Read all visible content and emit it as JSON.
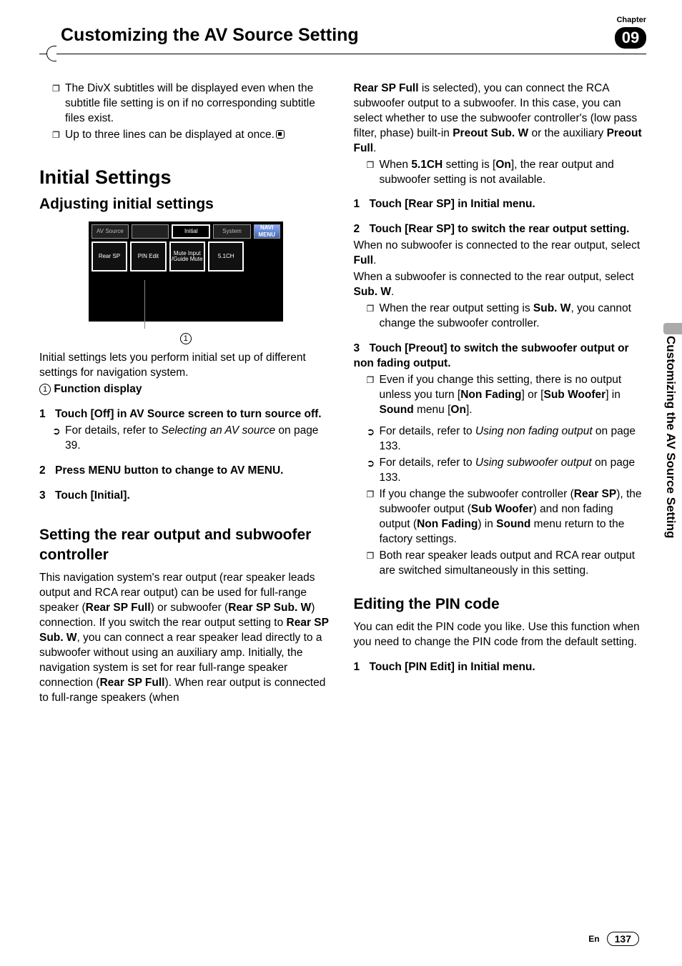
{
  "header": {
    "chapter_label": "Chapter",
    "title": "Customizing the AV Source Setting",
    "chapter_number": "09"
  },
  "side_tab": "Customizing the AV Source Setting",
  "footer": {
    "lang": "En",
    "page": "137"
  },
  "left": {
    "bullets_top": [
      "The DivX subtitles will be displayed even when the subtitle file setting is on if no corresponding subtitle files exist.",
      "Up to three lines can be displayed at once."
    ],
    "h1": "Initial Settings",
    "h2a": "Adjusting initial settings",
    "screenshot": {
      "tabs": [
        "AV Source",
        "",
        "Initial",
        "System",
        "NAVI MENU"
      ],
      "buttons": [
        "Rear SP",
        "PIN Edit",
        "Mute Input /Guide Mute",
        "5.1CH",
        ""
      ]
    },
    "caption_marker": "1",
    "intro": "Initial settings lets you perform initial set up of different settings for navigation system.",
    "func_display_label": "Function display",
    "step1": "Touch [Off] in AV Source screen to turn source off.",
    "step1_detail_prefix": "For details, refer to ",
    "step1_detail_italic": "Selecting an AV source",
    "step1_detail_suffix": " on page 39.",
    "step2": "Press MENU button to change to AV MENU.",
    "step3": "Touch [Initial].",
    "h2b": "Setting the rear output and subwoofer controller",
    "body_b_1": "This navigation system's rear output (rear speaker leads output and RCA rear output) can be used for full-range speaker (",
    "body_b_2": "Rear SP Full",
    "body_b_3": ") or subwoofer (",
    "body_b_4": "Rear SP Sub. W",
    "body_b_5": ") connection. If you switch the rear output setting to ",
    "body_b_6": "Rear SP Sub. W",
    "body_b_7": ", you can connect a rear speaker lead directly to a subwoofer without using an auxiliary amp. Initially, the navigation system is set for rear full-range speaker connection (",
    "body_b_8": "Rear SP Full",
    "body_b_9": "). When rear output is connected to full-range speakers (when"
  },
  "right": {
    "cont_1": "Rear SP Full",
    "cont_2": " is selected), you can connect the RCA subwoofer output to a subwoofer. In this case, you can select whether to use the subwoofer controller's (low pass filter, phase) built-in ",
    "cont_3": "Preout Sub. W",
    "cont_4": " or the auxiliary ",
    "cont_5": "Preout Full",
    "cont_6": ".",
    "bullet_51ch_1": "When ",
    "bullet_51ch_2": "5.1CH",
    "bullet_51ch_3": " setting is [",
    "bullet_51ch_4": "On",
    "bullet_51ch_5": "], the rear output and subwoofer setting is not available.",
    "step1": "Touch [Rear SP] in Initial menu.",
    "step2": "Touch [Rear SP] to switch the rear output setting.",
    "step2_body1": "When no subwoofer is connected to the rear output, select ",
    "step2_body1b": "Full",
    "step2_body2": "When a subwoofer is connected to the rear output, select ",
    "step2_body2b": "Sub. W",
    "step2_bullet_1": "When the rear output setting is ",
    "step2_bullet_1b": "Sub. W",
    "step2_bullet_2": ", you cannot change the subwoofer controller.",
    "step3": "Touch [Preout] to switch the subwoofer output or non fading output.",
    "s3_b1_a": "Even if you change this setting, there is no output unless you turn [",
    "s3_b1_b": "Non Fading",
    "s3_b1_c": "] or [",
    "s3_b1_d": "Sub Woofer",
    "s3_b1_e": "] in ",
    "s3_b1_f": "Sound",
    "s3_b1_g": " menu [",
    "s3_b1_h": "On",
    "s3_b1_i": "].",
    "s3_a1_a": "For details, refer to ",
    "s3_a1_b": "Using non fading output",
    "s3_a1_c": " on page 133.",
    "s3_a2_a": "For details, refer to ",
    "s3_a2_b": "Using subwoofer output",
    "s3_a2_c": " on page 133.",
    "s3_b2_a": "If you change the subwoofer controller (",
    "s3_b2_b": "Rear SP",
    "s3_b2_c": "), the subwoofer output (",
    "s3_b2_d": "Sub Woofer",
    "s3_b2_e": ") and non fading output (",
    "s3_b2_f": "Non Fading",
    "s3_b2_g": ") in ",
    "s3_b2_h": "Sound",
    "s3_b2_i": " menu return to the factory settings.",
    "s3_b3": "Both rear speaker leads output and RCA rear output are switched simultaneously in this setting.",
    "h2c": "Editing the PIN code",
    "pin_intro": "You can edit the PIN code you like. Use this function when you need to change the PIN code from the default setting.",
    "pin_step1": "Touch [PIN Edit] in Initial menu."
  }
}
